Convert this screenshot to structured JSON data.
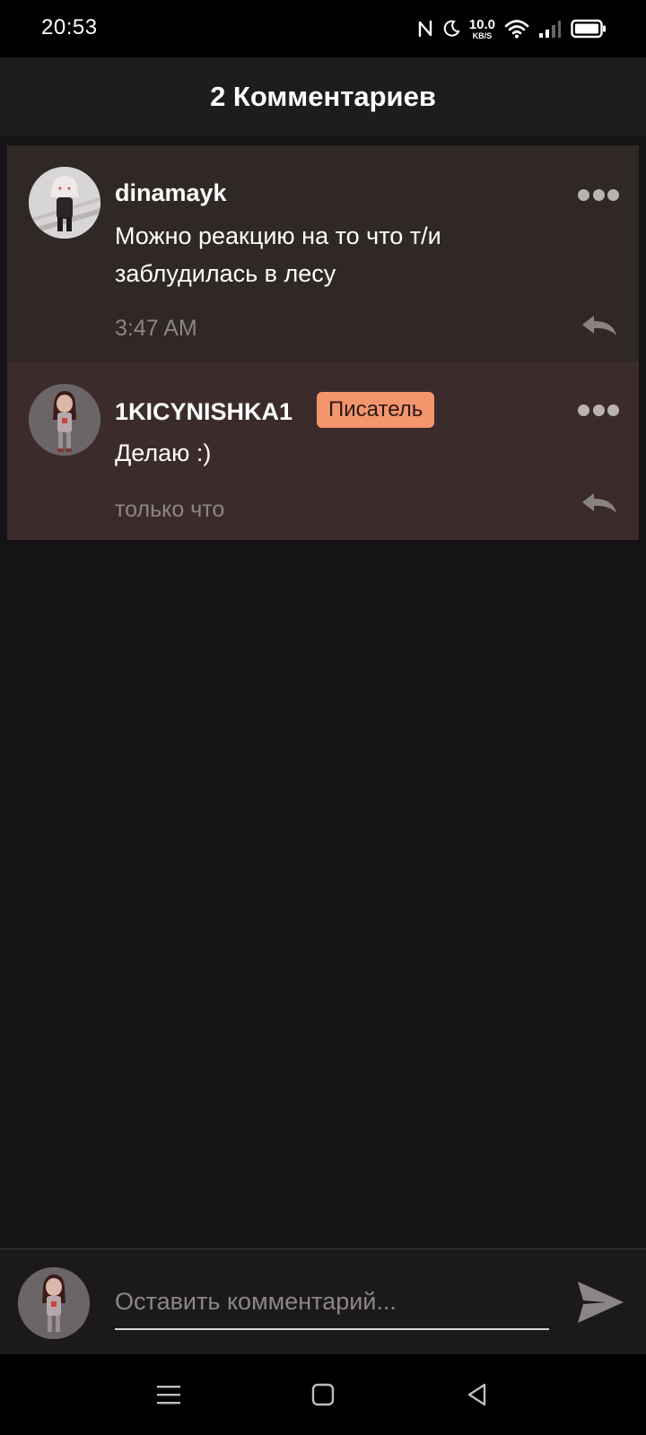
{
  "status_bar": {
    "time": "20:53",
    "net_speed_value": "10.0",
    "net_speed_unit": "KB/S",
    "icons": [
      "nfc-icon",
      "do-not-disturb-moon-icon",
      "wifi-icon",
      "signal-icon",
      "battery-icon"
    ]
  },
  "header": {
    "title": "2 Комментариев"
  },
  "comments": [
    {
      "username": "dinamayk",
      "text": "Можно реакцию на то что т/и заблудилась в лесу",
      "time": "3:47 AM",
      "badge": ""
    },
    {
      "username": "1KICYNISHKA1",
      "badge": "Писатель",
      "text": "Делаю :)",
      "time": "только что"
    }
  ],
  "input": {
    "placeholder": "Оставить комментарий..."
  },
  "colors": {
    "background": "#151315",
    "header": "#1e1c1e",
    "comment_1_bg": "#302825",
    "comment_2_bg": "#3b2c2b",
    "badge": "#f5956e",
    "muted_text": "#8c8584"
  }
}
